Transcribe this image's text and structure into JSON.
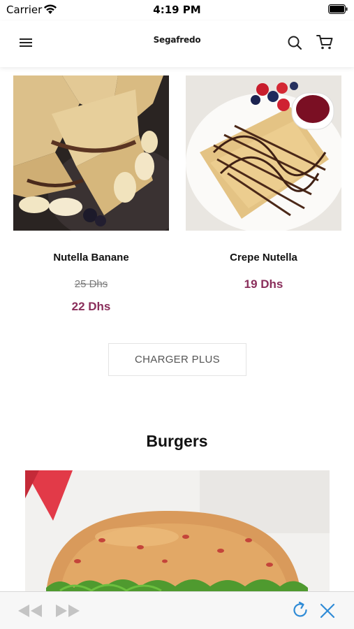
{
  "status_bar": {
    "carrier": "Carrier",
    "time": "4:19 PM"
  },
  "header": {
    "logo": "Segafredo",
    "menu_icon": "hamburger-menu-icon",
    "search_icon": "search-icon",
    "cart_icon": "shopping-cart-icon"
  },
  "products": [
    {
      "name": "Nutella Banane",
      "old_price": "25 Dhs",
      "price": "22 Dhs",
      "image": "crepes with banana and nutella"
    },
    {
      "name": "Crepe Nutella",
      "price": "19 Dhs",
      "image": "rolled crepes with chocolate drizzle and berries"
    }
  ],
  "load_more": "CHARGER PLUS",
  "section": {
    "title": "Burgers",
    "image": "burger"
  },
  "toolbar": {
    "back_icon": "rewind-icon",
    "forward_icon": "fast-forward-icon",
    "reload_icon": "reload-icon",
    "close_icon": "close-icon"
  },
  "colors": {
    "price": "#8a2e5b",
    "toolbar_icon_active": "#2f8bd6",
    "toolbar_icon_disabled": "#c4c4c4"
  }
}
